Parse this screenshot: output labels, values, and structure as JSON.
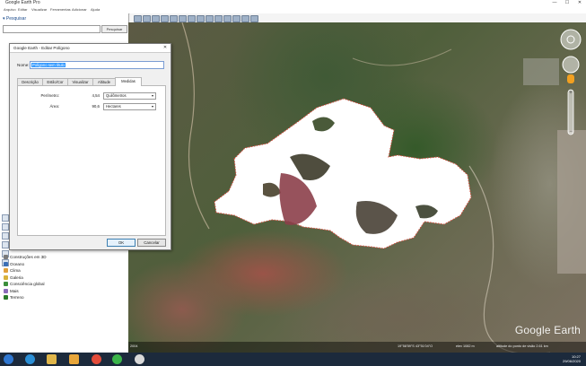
{
  "window": {
    "title": "Google Earth Pro",
    "min": "—",
    "max": "☐",
    "close": "✕"
  },
  "menu": [
    "Arquivo",
    "Editar",
    "Visualizar",
    "Ferramentas",
    "Adicionar",
    "Ajuda"
  ],
  "search": {
    "heading": "▾ Pesquisar",
    "placeholder": "",
    "button": "Pesquisar"
  },
  "places_tree": [
    {
      "label": "Construções em 3D",
      "color": "#7a7a7a"
    },
    {
      "label": "Oceano",
      "color": "#3b6fb6"
    },
    {
      "label": "Clima",
      "color": "#e0a03a"
    },
    {
      "label": "Galeria",
      "color": "#d8b23a"
    },
    {
      "label": "Consciência global",
      "color": "#3b8f3b"
    },
    {
      "label": "Mais",
      "color": "#8a6bb8"
    },
    {
      "label": "Terreno",
      "color": "#2a7a2a"
    }
  ],
  "dialog": {
    "title": "Google Earth - Editar Polígono",
    "close": "✕",
    "name_label": "Nome:",
    "name_value": "Polígono sem título",
    "tabs": [
      "Descrição",
      "Estilo/Cor",
      "Visualizar",
      "Altitude",
      "Medidas"
    ],
    "active_tab": "Medidas",
    "perimeter": {
      "label": "Perímetro:",
      "value": "4,54",
      "unit": "Quilômetros"
    },
    "area": {
      "label": "Área:",
      "value": "90,6",
      "unit": "Hectares"
    },
    "ok": "OK",
    "cancel": "Cancelar"
  },
  "map": {
    "watermark": "Google Earth",
    "year": "2004",
    "status_left": "Dados do mapa ©2020",
    "status_coords": "19°58'59\"S  43°51'04\"O",
    "status_elev": "elev 1082 m",
    "status_alt": "altitude do ponto de visão  2.61 km",
    "colors": {
      "polygon_fill": "#ffffff",
      "polygon_edge": "#d84a3a"
    }
  },
  "taskbar": {
    "time": "10:27",
    "date": "29/06/2020"
  }
}
